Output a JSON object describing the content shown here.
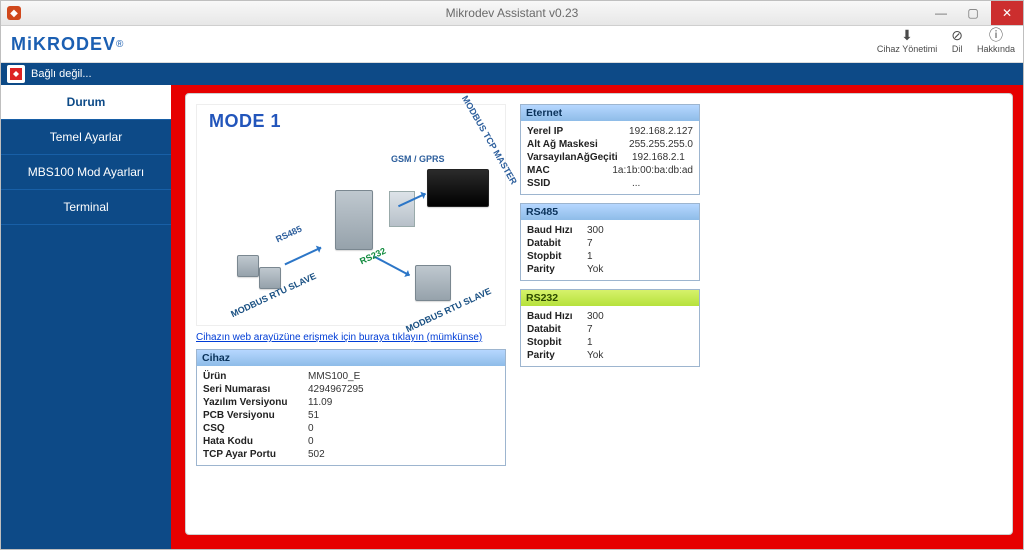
{
  "window": {
    "title": "Mikrodev Assistant v0.23"
  },
  "header": {
    "logo": "MiKRODEV",
    "actions": {
      "device_mgmt": "Cihaz Yönetimi",
      "lang": "Dil",
      "about": "Hakkında"
    }
  },
  "subbar": {
    "status": "Bağlı değil..."
  },
  "sidebar": {
    "items": [
      {
        "label": "Durum"
      },
      {
        "label": "Temel Ayarlar"
      },
      {
        "label": "MBS100 Mod Ayarları"
      },
      {
        "label": "Terminal"
      }
    ]
  },
  "diagram": {
    "title": "MODE 1",
    "labels": {
      "rs485": "RS485",
      "rs232": "RS232",
      "gsm": "GSM / GPRS",
      "tcp_master": "MODBUS TCP MASTER",
      "rtu_slave_1": "MODBUS RTU SLAVE",
      "rtu_slave_2": "MODBUS RTU SLAVE"
    }
  },
  "weblink": "Cihazın web arayüzüne erişmek için buraya tıklayın (mümkünse)",
  "device_box": {
    "title": "Cihaz",
    "rows": {
      "product_k": "Ürün",
      "product_v": "MMS100_E",
      "serial_k": "Seri Numarası",
      "serial_v": "4294967295",
      "sw_k": "Yazılım Versiyonu",
      "sw_v": "11.09",
      "pcb_k": "PCB Versiyonu",
      "pcb_v": "51",
      "csq_k": "CSQ",
      "csq_v": "0",
      "err_k": "Hata Kodu",
      "err_v": "0",
      "tcp_k": "TCP Ayar Portu",
      "tcp_v": "502"
    }
  },
  "eternet": {
    "title": "Eternet",
    "rows": {
      "ip_k": "Yerel IP",
      "ip_v": "192.168.2.127",
      "mask_k": "Alt Ağ Maskesi",
      "mask_v": "255.255.255.0",
      "gw_k": "VarsayılanAğGeçiti",
      "gw_v": "192.168.2.1",
      "mac_k": "MAC",
      "mac_v": "1a:1b:00:ba:db:ad",
      "ssid_k": "SSID",
      "ssid_v": "..."
    }
  },
  "rs485": {
    "title": "RS485",
    "rows": {
      "baud_k": "Baud Hızı",
      "baud_v": "300",
      "databit_k": "Databit",
      "databit_v": "7",
      "stopbit_k": "Stopbit",
      "stopbit_v": "1",
      "parity_k": "Parity",
      "parity_v": "Yok"
    }
  },
  "rs232": {
    "title": "RS232",
    "rows": {
      "baud_k": "Baud Hızı",
      "baud_v": "300",
      "databit_k": "Databit",
      "databit_v": "7",
      "stopbit_k": "Stopbit",
      "stopbit_v": "1",
      "parity_k": "Parity",
      "parity_v": "Yok"
    }
  }
}
